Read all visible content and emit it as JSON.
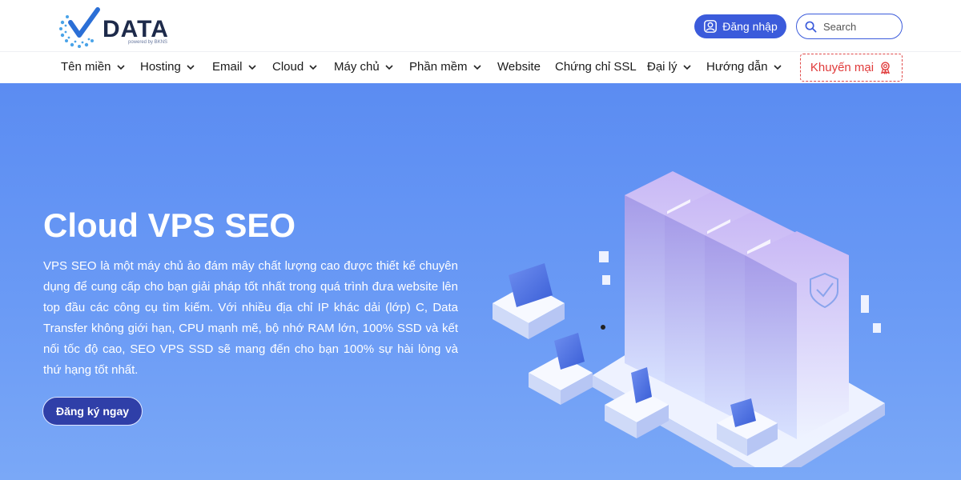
{
  "logo": {
    "wordmark": "DATA",
    "tagline": "powered by BKNS"
  },
  "header": {
    "login_label": "Đăng nhập",
    "search_placeholder": "Search"
  },
  "nav": {
    "items": [
      {
        "label": "Tên miền",
        "has_dropdown": true
      },
      {
        "label": "Hosting",
        "has_dropdown": true
      },
      {
        "label": "Email",
        "has_dropdown": true
      },
      {
        "label": "Cloud",
        "has_dropdown": true
      },
      {
        "label": "Máy chủ",
        "has_dropdown": true
      },
      {
        "label": "Phần mềm",
        "has_dropdown": true
      },
      {
        "label": "Website",
        "has_dropdown": false
      },
      {
        "label": "Chứng chỉ SSL",
        "has_dropdown": false
      },
      {
        "label": "Đại lý",
        "has_dropdown": true
      },
      {
        "label": "Hướng dẫn",
        "has_dropdown": true
      }
    ],
    "promo_label": "Khuyến mại"
  },
  "hero": {
    "title": "Cloud VPS SEO",
    "description": "VPS SEO là một máy chủ ảo đám mây chất lượng cao được thiết kế chuyên dụng để cung cấp cho bạn giải pháp tốt nhất trong quá trình đưa website lên top đầu các công cụ tìm kiếm. Với nhiều địa chỉ IP khác dải (lớp) C, Data Transfer không giới hạn, CPU mạnh mẽ, bộ nhớ RAM lớn, 100% SSD và kết nối tốc độ cao, SEO VPS SSD sẽ mang đến cho bạn 100% sự hài lòng và thứ hạng tốt nhất.",
    "cta_label": "Đăng ký ngay"
  },
  "colors": {
    "brand": "#3b5bdb",
    "hero_bg": "#6a9af5",
    "cta_bg": "#2f3fa8",
    "promo": "#e03a3a"
  }
}
